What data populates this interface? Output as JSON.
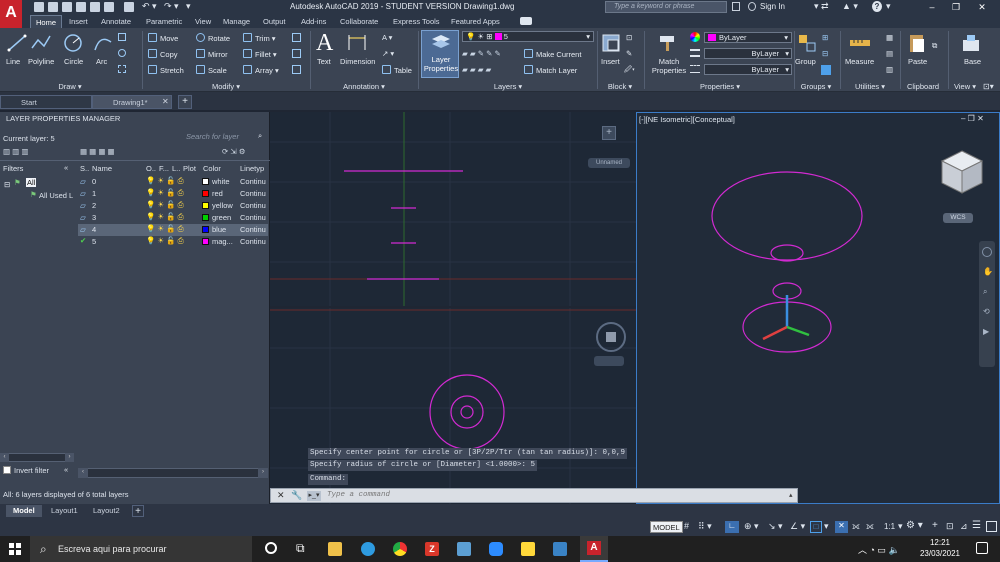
{
  "app": {
    "logo_letter": "A",
    "title": "Autodesk AutoCAD 2019 - STUDENT VERSION    Drawing1.dwg",
    "search_placeholder": "Type a keyword or phrase",
    "sign_in": "Sign In"
  },
  "menu_tabs": [
    "Home",
    "Insert",
    "Annotate",
    "Parametric",
    "View",
    "Manage",
    "Output",
    "Add-ins",
    "Collaborate",
    "Express Tools",
    "Featured Apps"
  ],
  "ribbon": {
    "draw": {
      "label": "Draw ▾",
      "line": "Line",
      "polyline": "Polyline",
      "circle": "Circle",
      "arc": "Arc"
    },
    "modify": {
      "label": "Modify ▾",
      "move": "Move",
      "rotate": "Rotate",
      "trim": "Trim",
      "copy": "Copy",
      "mirror": "Mirror",
      "fillet": "Fillet",
      "stretch": "Stretch",
      "scale": "Scale",
      "array": "Array"
    },
    "annotation": {
      "label": "Annotation ▾",
      "text": "Text",
      "dimension": "Dimension",
      "table": "Table"
    },
    "layers": {
      "label": "Layers ▾",
      "layer_properties": "Layer Properties",
      "current_layer": "5",
      "make_current": "Make Current",
      "match_layer": "Match Layer"
    },
    "block": {
      "label": "Block ▾",
      "insert": "Insert"
    },
    "properties": {
      "label": "Properties ▾",
      "match": "Match Properties",
      "color": "ByLayer",
      "lineweight": "ByLayer",
      "linetype": "ByLayer"
    },
    "groups": {
      "label": "Groups ▾",
      "group": "Group"
    },
    "utilities": {
      "label": "Utilities ▾",
      "measure": "Measure"
    },
    "clipboard": {
      "label": "Clipboard",
      "paste": "Paste"
    },
    "view": {
      "label": "View ▾",
      "base": "Base"
    }
  },
  "file_tabs": {
    "start": "Start",
    "drawing": "Drawing1*"
  },
  "layer_manager": {
    "title": "LAYER PROPERTIES MANAGER",
    "current_layer": "Current layer: 5",
    "search_placeholder": "Search for layer",
    "filters_label": "Filters",
    "filter_all": "All",
    "filter_used": "All Used L",
    "columns": [
      "S..",
      "Name",
      "O..",
      "F...",
      "L..",
      "Plot",
      "Color",
      "Linetyp"
    ],
    "layers": [
      {
        "name": "0",
        "color": "white",
        "hex": "#ffffff",
        "linetype": "Continu"
      },
      {
        "name": "1",
        "color": "red",
        "hex": "#ff0000",
        "linetype": "Continu"
      },
      {
        "name": "2",
        "color": "yellow",
        "hex": "#ffff00",
        "linetype": "Continu"
      },
      {
        "name": "3",
        "color": "green",
        "hex": "#00d000",
        "linetype": "Continu"
      },
      {
        "name": "4",
        "color": "blue",
        "hex": "#0000ff",
        "linetype": "Continu"
      },
      {
        "name": "5",
        "color": "mag...",
        "hex": "#ff00ff",
        "linetype": "Continu"
      }
    ],
    "selected_layer": "4",
    "invert_filter": "Invert filter",
    "status": "All: 6 layers displayed of 6 total layers"
  },
  "viewports": {
    "right_label": "[-][NE Isometric][Conceptual]",
    "wcs": "WCS",
    "top_badge": "Unnamed"
  },
  "command": {
    "history": [
      "Specify center point for circle or [3P/2P/Ttr (tan tan radius)]: 0,0,9",
      "Specify radius of circle or [Diameter] <1.0000>: 5",
      "Command:"
    ],
    "placeholder": "Type a command"
  },
  "layout_tabs": [
    "Model",
    "Layout1",
    "Layout2"
  ],
  "statusbar": {
    "model": "MODEL",
    "scale": "1:1"
  },
  "taskbar": {
    "search": "Escreva aqui para procurar",
    "time": "12:21",
    "date": "23/03/2021"
  },
  "colors": {
    "magenta": "#d22ad2",
    "accent": "#4ea0ea"
  }
}
